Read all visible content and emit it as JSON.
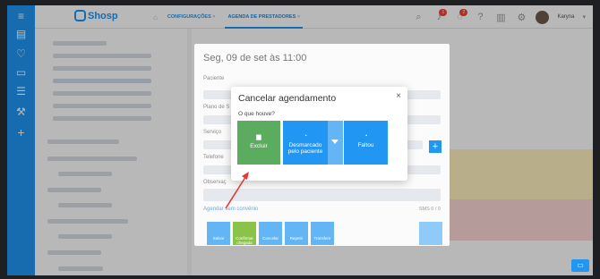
{
  "header": {
    "logo_text": "Shosp",
    "tabs": [
      "CONFIGURAÇÕES",
      "AGENDA DE PRESTADORES"
    ],
    "user_name": "Karyna",
    "notif_badge": "1",
    "chat_badge": "2"
  },
  "background_modal": {
    "title": "Seg, 09 de set às 11:00",
    "labels": [
      "Paciente",
      "Plano de S",
      "Serviço",
      "Telefone",
      "Observaç"
    ],
    "bottom_link": "Agendar sem convênio",
    "bottom_count": "SMS 0 / 0",
    "buttons": [
      "Salvar",
      "Confirmar chegada",
      "Cancelar",
      "Repetir",
      "Transferir"
    ]
  },
  "dialog": {
    "title": "Cancelar agendamento",
    "question": "O que houve?",
    "options": {
      "excluir": "Excluir",
      "desmarcado": "Desmarcado pelo paciente",
      "faltou": "Faltou"
    }
  },
  "colors": {
    "primary": "#2196f3",
    "success": "#5cac5f",
    "arrow": "#e53935"
  }
}
